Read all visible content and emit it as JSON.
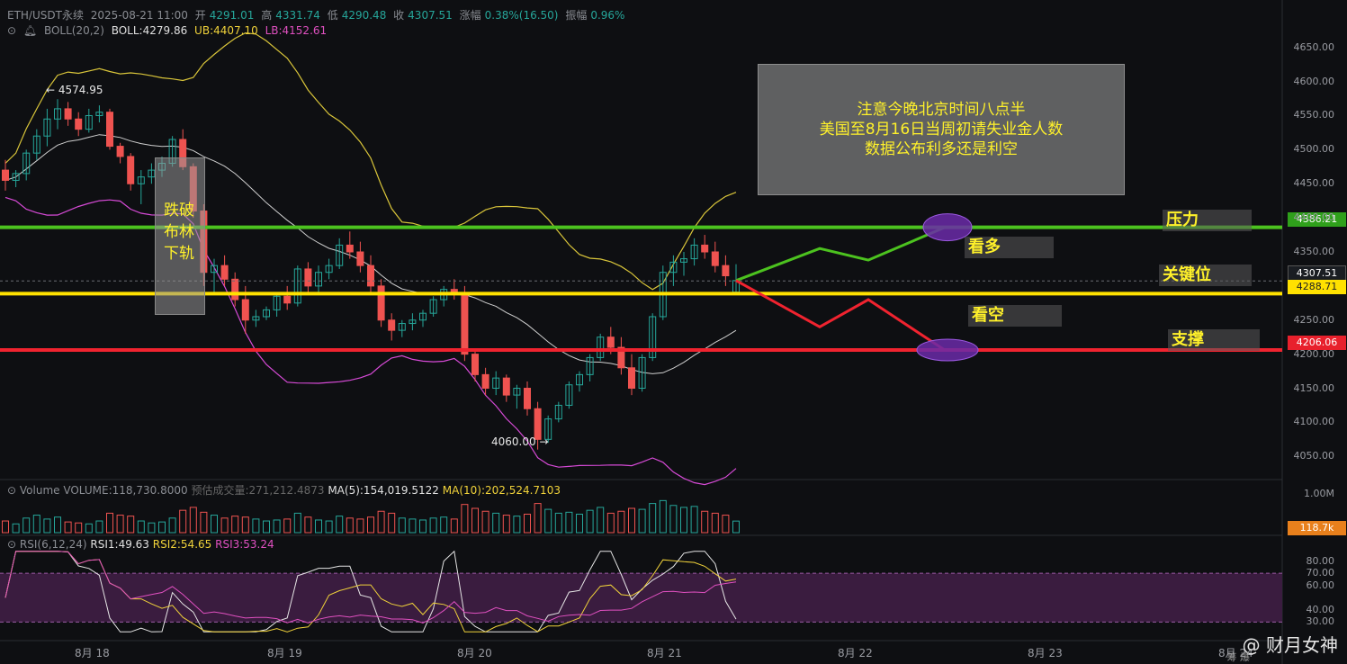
{
  "header": {
    "symbol": "ETH/USDT永续",
    "datetime": "2025-08-21 11:00",
    "open_label": "开",
    "open": "4291.01",
    "high_label": "高",
    "high": "4331.74",
    "low_label": "低",
    "low": "4290.48",
    "close_label": "收",
    "close": "4307.51",
    "change_label": "涨幅",
    "change": "0.38%(16.50)",
    "amp_label": "振幅",
    "amp": "0.96%"
  },
  "boll": {
    "label": "BOLL(20,2)",
    "mid": "BOLL:4279.86",
    "ub": "UB:4407.10",
    "lb": "LB:4152.61"
  },
  "annotation": {
    "line1": "注意今晚北京时间八点半",
    "line2": "美国至8月16日当周初请失业金人数",
    "line3": "数据公布利多还是利空"
  },
  "breakdown": {
    "line1": "跌破",
    "line2": "布林",
    "line3": "下轨"
  },
  "levels": {
    "resistance_label": "压力",
    "resistance": "4386.21",
    "key_label": "关键位",
    "current": "4307.51",
    "key": "4288.71",
    "support_label": "支撑",
    "support": "4206.06",
    "bull_label": "看多",
    "bear_label": "看空"
  },
  "extremes": {
    "high": "4574.95",
    "low": "4060.00"
  },
  "volume_panel": {
    "label": "Volume",
    "volume": "VOLUME:118,730.8000",
    "est": "预估成交量:271,212.4873",
    "ma5": "MA(5):154,019.5122",
    "ma10": "MA(10):202,524.7103",
    "axis_top": "1.00M",
    "current": "118.7k"
  },
  "rsi_panel": {
    "label": "RSI(6,12,24)",
    "rsi1": "RSI1:49.63",
    "rsi2": "RSI2:54.65",
    "rsi3": "RSI3:53.24"
  },
  "colors": {
    "up": "#26a69a",
    "down": "#ef5350",
    "resistance": "#4cc21f",
    "key": "#ffe100",
    "support": "#f0232f",
    "rsi_band": "#3a1c3f",
    "boll_outer": "#d9c53a",
    "boll_lower": "#d64ad6"
  },
  "watermark": {
    "text": "@ 财月女神",
    "sub": "筹 爆"
  },
  "chart_data": {
    "type": "candlestick",
    "x_ticks": [
      "8月 18",
      "8月 19",
      "8月 20",
      "8月 21",
      "8月 22",
      "8月 23",
      "8月 24"
    ],
    "price_ticks": [
      "4650.00",
      "4600.00",
      "4550.00",
      "4500.00",
      "4450.00",
      "4400.00",
      "4350.00",
      "4250.00",
      "4200.00",
      "4150.00",
      "4100.00",
      "4050.00"
    ],
    "rsi_ticks": [
      "80.00",
      "70.00",
      "60.00",
      "40.00",
      "30.00"
    ],
    "ylim": [
      4020,
      4680
    ],
    "ohlc": [
      [
        4470,
        4485,
        4440,
        4455
      ],
      [
        4455,
        4470,
        4445,
        4465
      ],
      [
        4465,
        4500,
        4455,
        4495
      ],
      [
        4495,
        4530,
        4485,
        4520
      ],
      [
        4520,
        4560,
        4505,
        4545
      ],
      [
        4545,
        4574,
        4530,
        4560
      ],
      [
        4560,
        4570,
        4535,
        4545
      ],
      [
        4545,
        4555,
        4520,
        4530
      ],
      [
        4530,
        4560,
        4525,
        4550
      ],
      [
        4550,
        4565,
        4540,
        4555
      ],
      [
        4555,
        4560,
        4500,
        4505
      ],
      [
        4505,
        4510,
        4480,
        4490
      ],
      [
        4490,
        4495,
        4440,
        4450
      ],
      [
        4450,
        4470,
        4420,
        4460
      ],
      [
        4460,
        4480,
        4450,
        4470
      ],
      [
        4470,
        4490,
        4460,
        4480
      ],
      [
        4480,
        4520,
        4475,
        4515
      ],
      [
        4515,
        4530,
        4470,
        4475
      ],
      [
        4475,
        4480,
        4400,
        4410
      ],
      [
        4410,
        4420,
        4300,
        4320
      ],
      [
        4320,
        4340,
        4290,
        4330
      ],
      [
        4330,
        4345,
        4300,
        4310
      ],
      [
        4310,
        4320,
        4270,
        4280
      ],
      [
        4280,
        4300,
        4230,
        4250
      ],
      [
        4250,
        4265,
        4240,
        4255
      ],
      [
        4255,
        4270,
        4250,
        4265
      ],
      [
        4265,
        4290,
        4255,
        4285
      ],
      [
        4285,
        4300,
        4265,
        4275
      ],
      [
        4275,
        4330,
        4270,
        4325
      ],
      [
        4325,
        4335,
        4290,
        4300
      ],
      [
        4300,
        4330,
        4290,
        4320
      ],
      [
        4320,
        4340,
        4310,
        4330
      ],
      [
        4330,
        4370,
        4325,
        4360
      ],
      [
        4360,
        4380,
        4340,
        4350
      ],
      [
        4350,
        4365,
        4320,
        4330
      ],
      [
        4330,
        4345,
        4290,
        4300
      ],
      [
        4300,
        4310,
        4240,
        4250
      ],
      [
        4250,
        4260,
        4220,
        4235
      ],
      [
        4235,
        4250,
        4225,
        4245
      ],
      [
        4245,
        4260,
        4235,
        4250
      ],
      [
        4250,
        4265,
        4240,
        4260
      ],
      [
        4260,
        4285,
        4255,
        4280
      ],
      [
        4280,
        4300,
        4270,
        4295
      ],
      [
        4295,
        4310,
        4280,
        4290
      ],
      [
        4290,
        4300,
        4190,
        4200
      ],
      [
        4200,
        4205,
        4160,
        4170
      ],
      [
        4170,
        4180,
        4140,
        4150
      ],
      [
        4150,
        4175,
        4140,
        4165
      ],
      [
        4165,
        4170,
        4130,
        4140
      ],
      [
        4140,
        4155,
        4120,
        4150
      ],
      [
        4150,
        4160,
        4110,
        4120
      ],
      [
        4120,
        4130,
        4060,
        4075
      ],
      [
        4075,
        4110,
        4070,
        4105
      ],
      [
        4105,
        4130,
        4100,
        4125
      ],
      [
        4125,
        4160,
        4120,
        4155
      ],
      [
        4155,
        4175,
        4145,
        4170
      ],
      [
        4170,
        4200,
        4160,
        4195
      ],
      [
        4195,
        4230,
        4190,
        4225
      ],
      [
        4225,
        4240,
        4200,
        4210
      ],
      [
        4210,
        4225,
        4170,
        4180
      ],
      [
        4180,
        4200,
        4140,
        4150
      ],
      [
        4150,
        4200,
        4145,
        4195
      ],
      [
        4195,
        4260,
        4190,
        4255
      ],
      [
        4255,
        4330,
        4250,
        4320
      ],
      [
        4320,
        4345,
        4300,
        4335
      ],
      [
        4335,
        4350,
        4315,
        4340
      ],
      [
        4340,
        4370,
        4330,
        4360
      ],
      [
        4360,
        4375,
        4340,
        4350
      ],
      [
        4350,
        4365,
        4320,
        4330
      ],
      [
        4330,
        4345,
        4300,
        4315
      ],
      [
        4291,
        4332,
        4290,
        4308
      ]
    ],
    "volume": [
      120,
      90,
      150,
      180,
      140,
      160,
      110,
      100,
      90,
      120,
      200,
      180,
      170,
      120,
      100,
      110,
      150,
      230,
      260,
      210,
      180,
      150,
      170,
      160,
      140,
      120,
      130,
      140,
      200,
      160,
      130,
      120,
      170,
      150,
      140,
      160,
      220,
      200,
      150,
      140,
      130,
      150,
      160,
      140,
      290,
      250,
      220,
      200,
      180,
      170,
      190,
      300,
      240,
      200,
      210,
      190,
      230,
      260,
      200,
      220,
      250,
      240,
      300,
      330,
      280,
      260,
      270,
      220,
      200,
      180,
      119
    ]
  }
}
